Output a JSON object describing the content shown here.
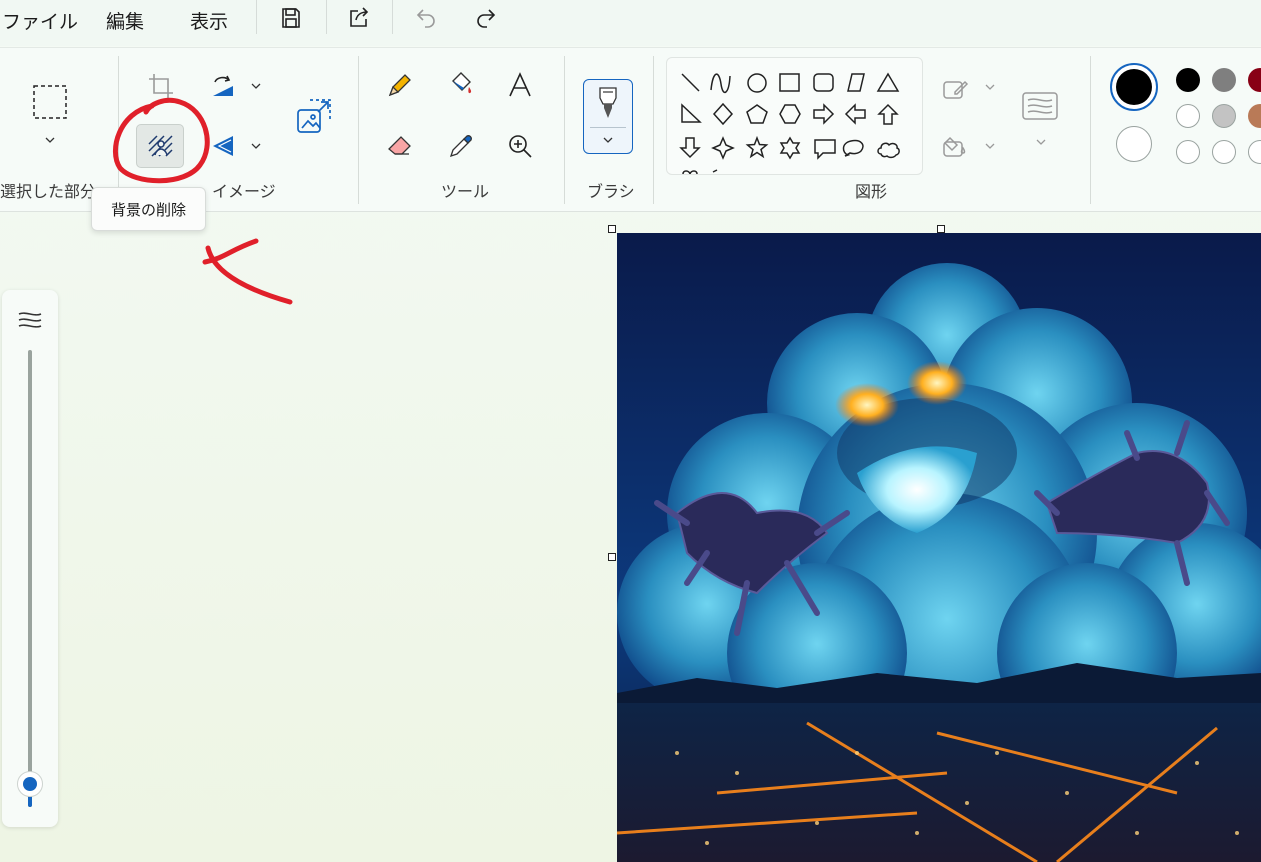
{
  "menu": {
    "file": "ファイル",
    "edit": "編集",
    "view": "表示"
  },
  "quick_access": {
    "save_icon": "save-icon",
    "share_icon": "share-icon",
    "undo_icon": "undo-icon",
    "redo_icon": "redo-icon"
  },
  "ribbon": {
    "selection_label": "選択した部分",
    "image_label": "イメージ",
    "tools_label": "ツール",
    "brush_label": "ブラシ",
    "shapes_label": "図形"
  },
  "shapes": [
    "line",
    "curve",
    "oval",
    "rectangle",
    "rounded-rectangle",
    "polygon",
    "triangle",
    "right-triangle",
    "diamond",
    "pentagon",
    "hexagon",
    "right-arrow",
    "left-arrow",
    "up-arrow",
    "down-arrow",
    "four-point-star",
    "five-point-star",
    "six-point-star",
    "rounded-callout",
    "oval-callout",
    "cloud-callout",
    "heart",
    "lightning"
  ],
  "colors": {
    "primary": "#000000",
    "secondary": "#ffffff",
    "palette_row1": [
      "#000000",
      "#7f7f7f",
      "#880015"
    ],
    "palette_row2": [
      "#ffffff",
      "#c3c3c3",
      "#b97a57"
    ],
    "palette_row3": [
      "#ffffff",
      "#ffffff",
      "#ffffff"
    ],
    "annotation_red": "#e0202a"
  },
  "tooltip": {
    "text": "背景の削除"
  },
  "zoom": {
    "level": 0.05
  },
  "canvas": {
    "image_subject": "cloud-monster-over-night-city-image"
  }
}
